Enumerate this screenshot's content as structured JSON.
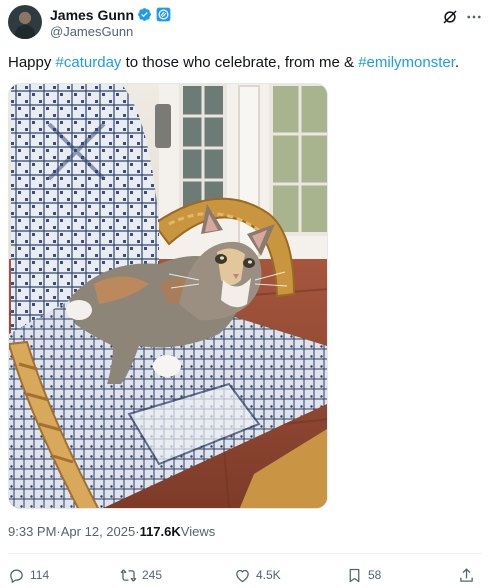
{
  "author": {
    "name": "James Gunn",
    "handle": "@JamesGunn"
  },
  "tweet": {
    "text_parts": [
      "Happy ",
      "#caturday",
      " to those who celebrate, from me & ",
      "#emilymonster",
      "."
    ]
  },
  "meta": {
    "time": "9:33 PM",
    "sep1": " · ",
    "date": "Apr 12, 2025",
    "sep2": " · ",
    "views_count": "117.6K",
    "views_label": " Views"
  },
  "actions": {
    "replies": "114",
    "reposts": "245",
    "likes": "4.5K",
    "bookmarks": "58"
  },
  "colors": {
    "accent": "#1d9bf0",
    "text": "#0f1419",
    "secondary": "#536471"
  },
  "icons": [
    "verified-icon",
    "affiliate-badge-icon",
    "grok-icon",
    "more-icon",
    "reply-icon",
    "repost-icon",
    "like-icon",
    "bookmark-icon",
    "share-icon"
  ]
}
